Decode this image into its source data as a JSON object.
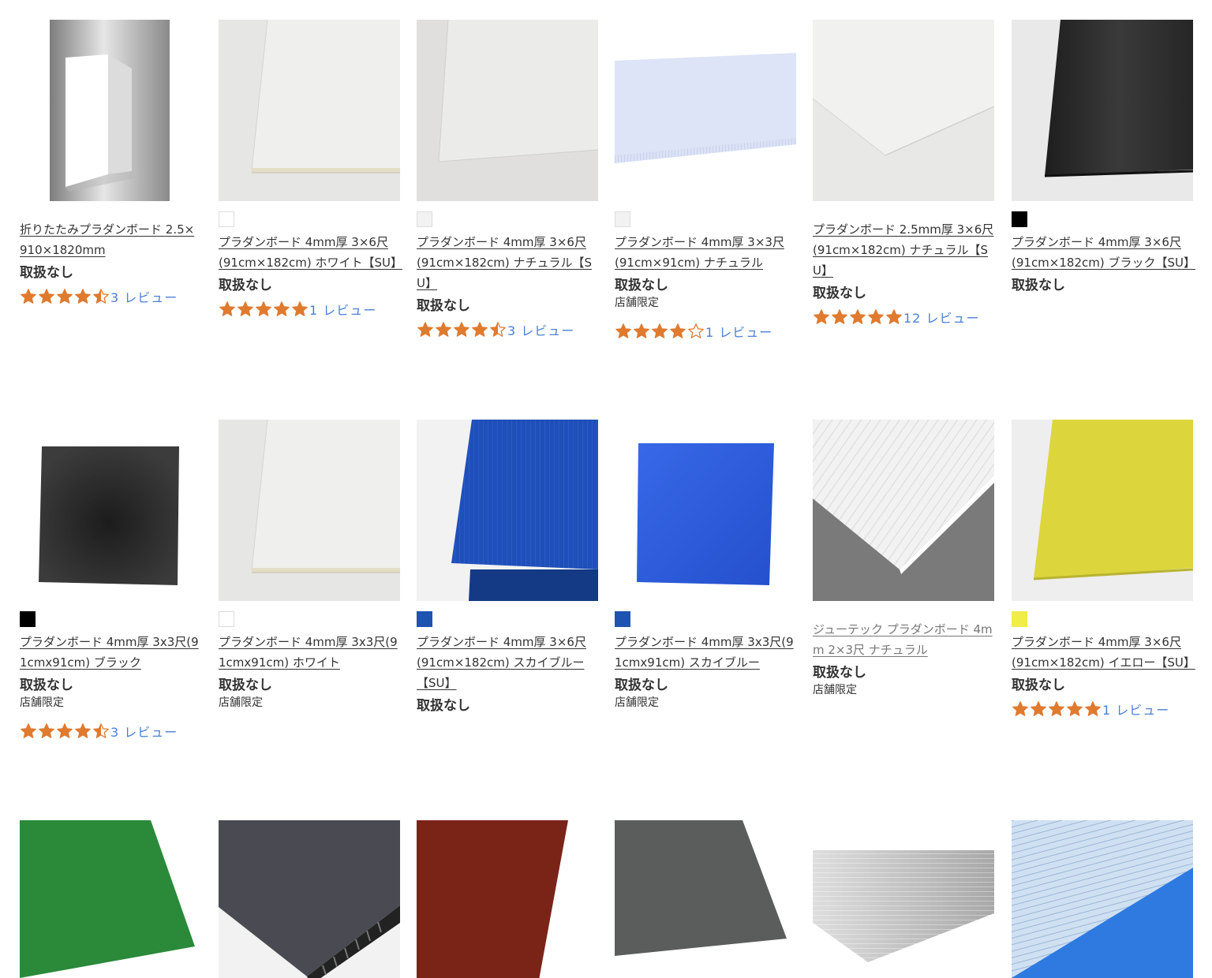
{
  "colors": {
    "star": "#e07a2f",
    "review_link": "#4a7fd6",
    "white_swatch": "#ffffff",
    "natural_swatch": "#f2f2f2",
    "black_swatch": "#000000",
    "blue_swatch": "#1f53b0",
    "yellow_swatch": "#f0ec48"
  },
  "products": [
    {
      "name": "折りたたみプラダンボード 2.5×910×1820mm",
      "stock": "取扱なし",
      "rating": 4.5,
      "reviews": "3 レビュー"
    },
    {
      "name": "プラダンボード 4mm厚 3×6尺(91cm×182cm) ホワイト【SU】",
      "swatch_color": "#ffffff",
      "stock": "取扱なし",
      "rating": 5,
      "reviews": "1 レビュー"
    },
    {
      "name": "プラダンボード 4mm厚 3×6尺(91cm×182cm) ナチュラル【SU】",
      "swatch_color": "#f2f2f2",
      "stock": "取扱なし",
      "rating": 4.5,
      "reviews": "3 レビュー"
    },
    {
      "name": "プラダンボード 4mm厚 3×3尺(91cm×91cm) ナチュラル",
      "swatch_color": "#f2f2f2",
      "stock": "取扱なし",
      "store_only": "店舗限定",
      "rating": 4,
      "reviews": "1 レビュー"
    },
    {
      "name": "プラダンボード 2.5mm厚 3×6尺(91cm×182cm) ナチュラル【SU】",
      "stock": "取扱なし",
      "rating": 5,
      "reviews": "12 レビュー"
    },
    {
      "name": "プラダンボード 4mm厚 3×6尺(91cm×182cm) ブラック【SU】",
      "swatch_color": "#000000",
      "stock": "取扱なし"
    },
    {
      "name": "プラダンボード 4mm厚 3x3尺(91cmx91cm) ブラック",
      "swatch_color": "#000000",
      "stock": "取扱なし",
      "store_only": "店舗限定",
      "rating": 4.5,
      "reviews": "3 レビュー"
    },
    {
      "name": "プラダンボード 4mm厚 3x3尺(91cmx91cm) ホワイト",
      "swatch_color": "#ffffff",
      "stock": "取扱なし",
      "store_only": "店舗限定"
    },
    {
      "name": "プラダンボード 4mm厚 3×6尺(91cm×182cm) スカイブルー【SU】",
      "swatch_color": "#1f53b0",
      "stock": "取扱なし"
    },
    {
      "name": "プラダンボード 4mm厚 3x3尺(91cmx91cm) スカイブルー",
      "swatch_color": "#1f53b0",
      "stock": "取扱なし",
      "store_only": "店舗限定"
    },
    {
      "name": "ジューテック プラダンボード 4mm 2×3尺 ナチュラル",
      "stock": "取扱なし",
      "store_only": "店舗限定"
    },
    {
      "name": "プラダンボード 4mm厚 3×6尺(91cm×182cm) イエロー【SU】",
      "swatch_color": "#f0ec48",
      "stock": "取扱なし",
      "rating": 5,
      "reviews": "1 レビュー"
    },
    {
      "image": "green-board"
    },
    {
      "image": "gray-board"
    },
    {
      "image": "red-board"
    },
    {
      "image": "dark-gray-board"
    },
    {
      "image": "clear-board"
    },
    {
      "image": "clear-board-on-blue"
    }
  ]
}
